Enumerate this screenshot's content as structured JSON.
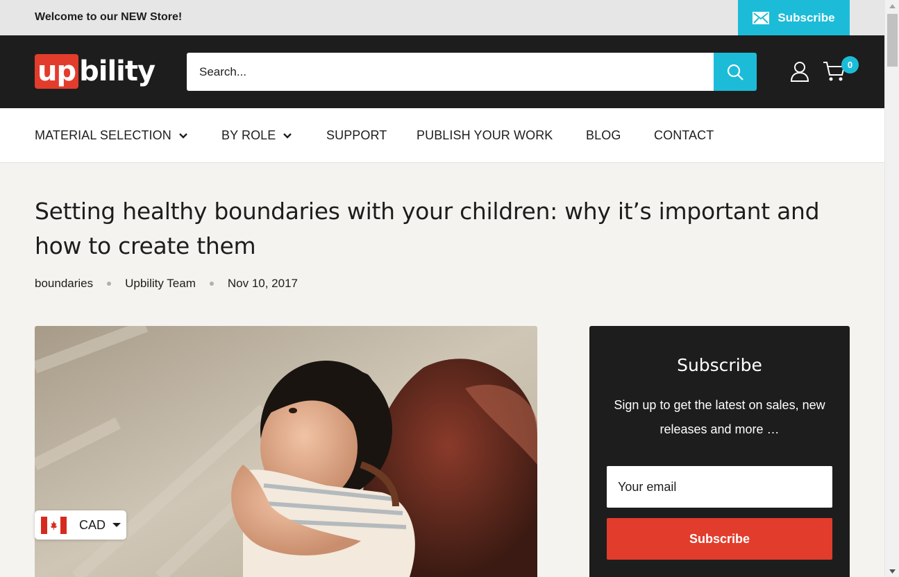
{
  "announcement": {
    "text": "Welcome to our NEW Store!",
    "subscribe_label": "Subscribe"
  },
  "header": {
    "logo": {
      "part1": "up",
      "part2": "bility"
    },
    "search_placeholder": "Search...",
    "cart_count": "0"
  },
  "nav": {
    "items": [
      {
        "label": "MATERIAL SELECTION",
        "has_dropdown": true
      },
      {
        "label": "BY ROLE",
        "has_dropdown": true
      },
      {
        "label": "SUPPORT",
        "has_dropdown": false
      },
      {
        "label": "PUBLISH YOUR WORK",
        "has_dropdown": false
      },
      {
        "label": "BLOG",
        "has_dropdown": false
      },
      {
        "label": "CONTACT",
        "has_dropdown": false
      }
    ]
  },
  "article": {
    "title": "Setting healthy boundaries with your children: why it’s important and how to create them",
    "tag": "boundaries",
    "author": "Upbility Team",
    "date": "Nov 10, 2017"
  },
  "currency": {
    "code": "CAD"
  },
  "subscribe_box": {
    "title": "Subscribe",
    "text": "Sign up to get the latest on sales, new releases and more …",
    "email_placeholder": "Your email",
    "button_label": "Subscribe"
  },
  "colors": {
    "accent": "#1cbcd8",
    "brand_red": "#e23c2c",
    "dark": "#1e1d1d",
    "background": "#f4f3ef"
  }
}
